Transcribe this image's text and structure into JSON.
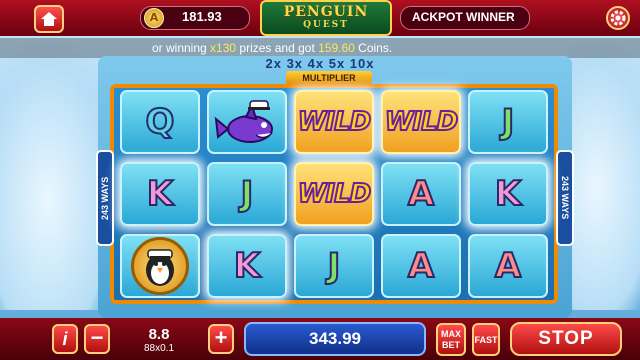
{
  "top_bar": {
    "coin_symbol": "A",
    "balance": "181.93",
    "logo_title": "PENGUIN",
    "logo_subtitle": "QUEST",
    "jackpot_label": "ACKPOT WINNER"
  },
  "ticker": {
    "part1": "or winning ",
    "multiplier": "x130",
    "part2": " prizes and got ",
    "amount": "159.60",
    "part3": " Coins."
  },
  "multiplier": {
    "values_text": "2x  3x  4x  5x  10x",
    "label": "MULTIPLIER"
  },
  "ways": {
    "left": "243 WAYS",
    "right": "243 WAYS"
  },
  "reels": {
    "r0c0": "Q",
    "r0c2": "WILD",
    "r0c3": "WILD",
    "r0c4": "J",
    "r1c0": "K",
    "r1c1": "J",
    "r1c2": "WILD",
    "r1c3": "A",
    "r1c4": "K",
    "r2c1": "K",
    "r2c2": "J",
    "r2c3": "A",
    "r2c4": "A"
  },
  "symbol_icons": {
    "r0c1": "shark-sailor-icon",
    "r2c0": "penguin-captain-icon"
  },
  "bottom_bar": {
    "info_label": "i",
    "minus_label": "−",
    "plus_label": "+",
    "bet": "8.8",
    "bet_detail": "88x0.1",
    "win": "343.99",
    "maxbet_label": "MAX BET",
    "fast_label": "FAST",
    "stop_label": "STOP"
  },
  "colors": {
    "frame_border": "#f08a00",
    "top_bar": "#b01020",
    "ticker_highlight": "#ffe75a"
  }
}
